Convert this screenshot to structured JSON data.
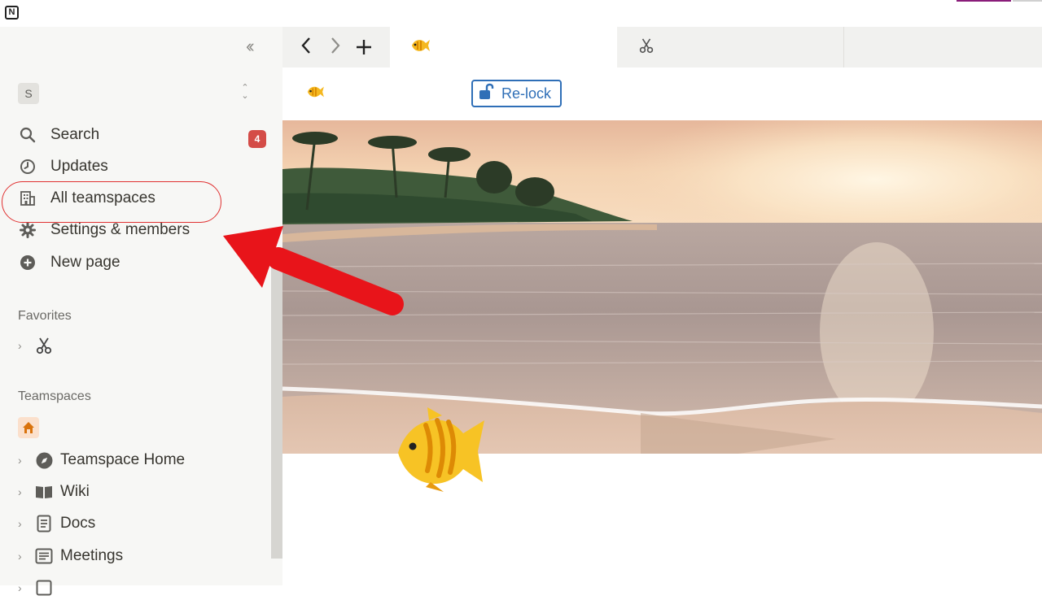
{
  "app": {
    "logo_letter": "N"
  },
  "sidebar": {
    "workspace_initial": "S",
    "nav": [
      {
        "label": "Search",
        "icon": "search-icon"
      },
      {
        "label": "Updates",
        "icon": "clock-icon",
        "badge": "4"
      },
      {
        "label": "All teamspaces",
        "icon": "building-icon"
      },
      {
        "label": "Settings & members",
        "icon": "gear-icon"
      },
      {
        "label": "New page",
        "icon": "plus-circle-icon"
      }
    ],
    "favorites_label": "Favorites",
    "teamspaces_label": "Teamspaces",
    "teamspace_items": [
      {
        "label": "Teamspace Home",
        "icon": "compass-icon"
      },
      {
        "label": "Wiki",
        "icon": "book-icon"
      },
      {
        "label": "Docs",
        "icon": "document-icon"
      },
      {
        "label": "Meetings",
        "icon": "notes-icon"
      }
    ]
  },
  "page": {
    "relock_label": "Re-lock"
  },
  "colors": {
    "sidebar_bg": "#f7f7f5",
    "badge": "#d44c47",
    "relock_blue": "#2f6fb7",
    "annotation_red": "#e8141a"
  }
}
